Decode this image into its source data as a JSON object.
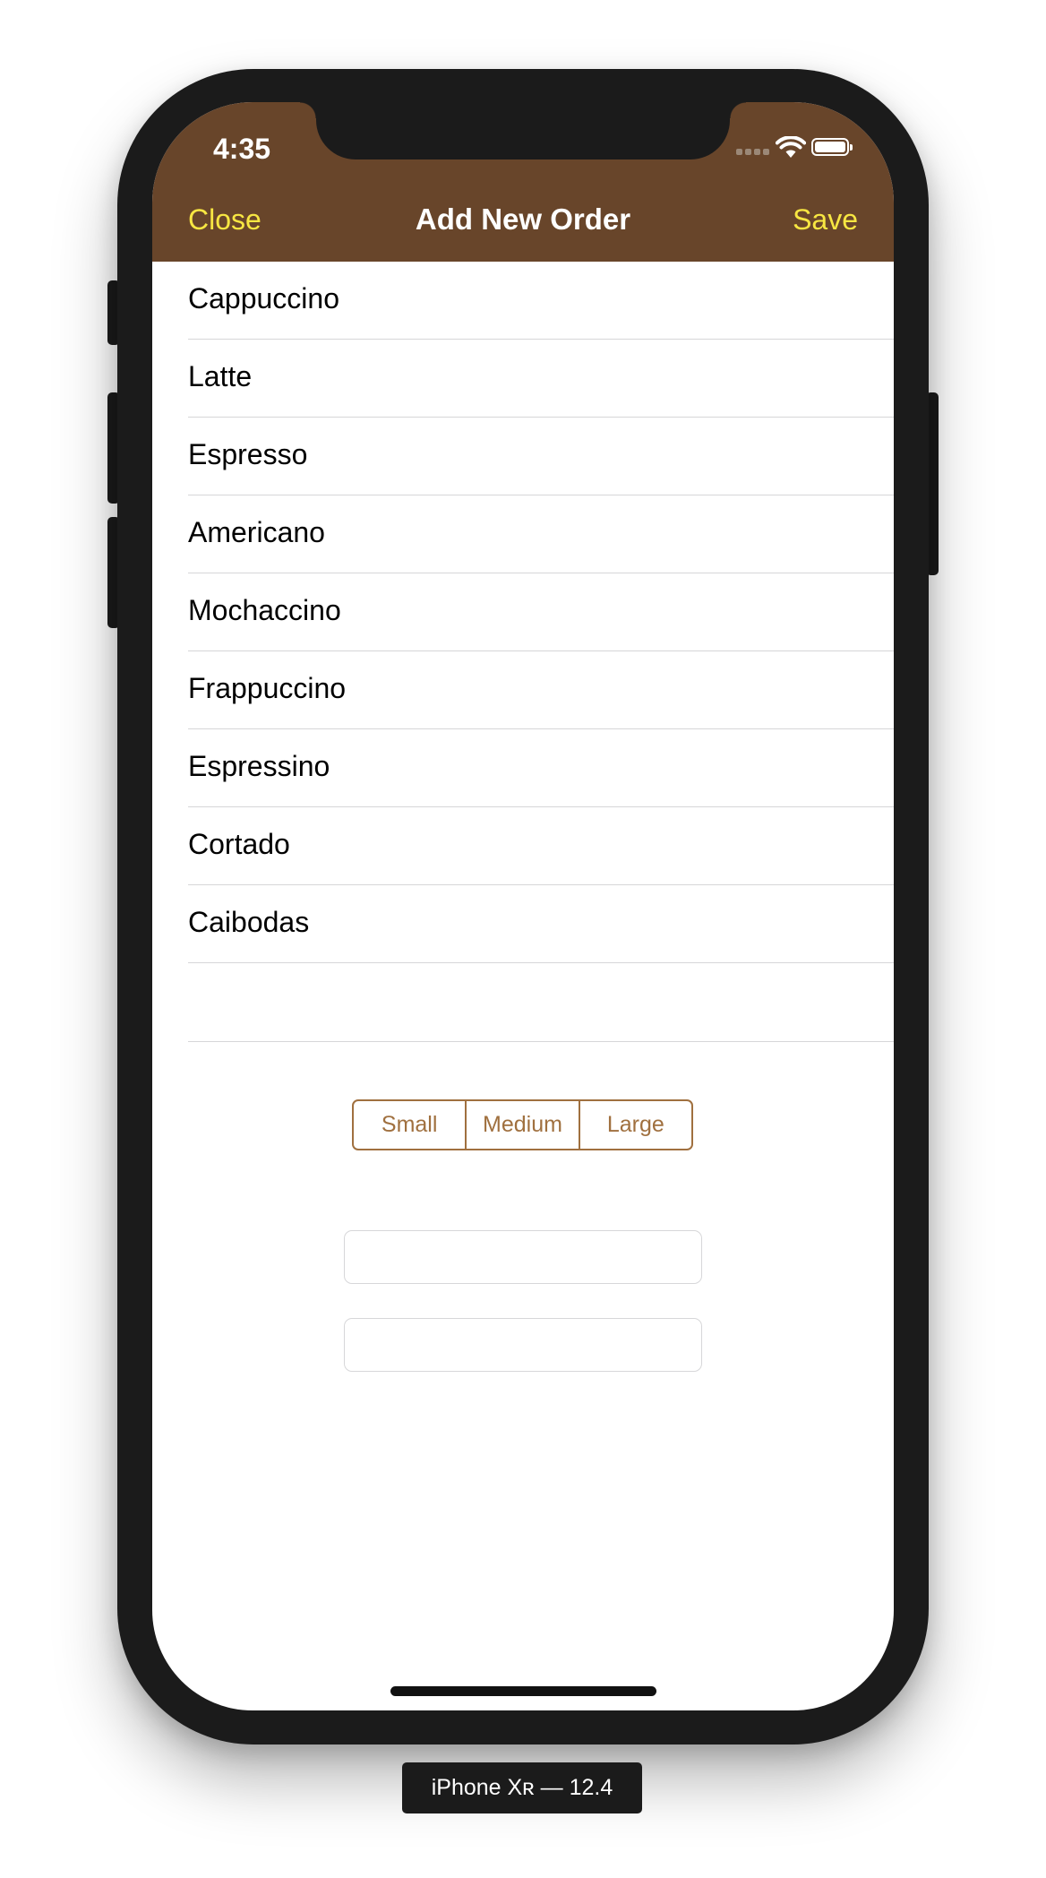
{
  "status_bar": {
    "time": "4:35"
  },
  "nav": {
    "close_label": "Close",
    "title": "Add New Order",
    "save_label": "Save"
  },
  "coffee_list": [
    "Cappuccino",
    "Latte",
    "Espresso",
    "Americano",
    "Mochaccino",
    "Frappuccino",
    "Espressino",
    "Cortado",
    "Caibodas"
  ],
  "size_selector": {
    "options": [
      "Small",
      "Medium",
      "Large"
    ]
  },
  "inputs": {
    "field_1_value": "",
    "field_2_value": ""
  },
  "device_label": "iPhone Xʀ — 12.4",
  "colors": {
    "nav_background": "#68452a",
    "nav_button": "#f7e642",
    "segment_tint": "#a0703f"
  },
  "icons": {
    "wifi": "wifi-icon",
    "battery": "battery-icon",
    "signal": "cellular-signal-icon"
  }
}
